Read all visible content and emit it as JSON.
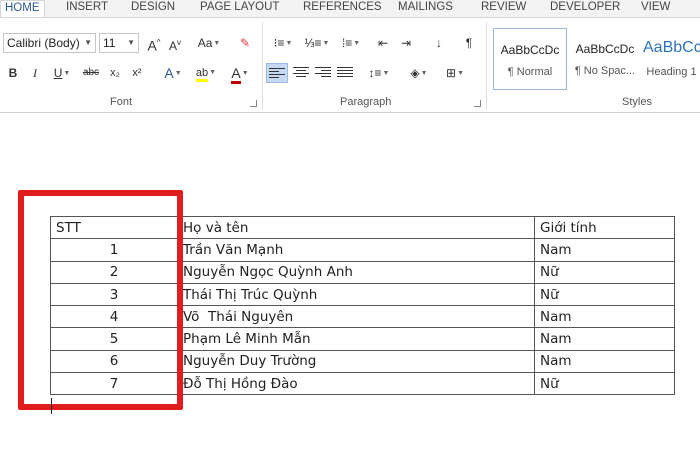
{
  "tabs": [
    "HOME",
    "INSERT",
    "DESIGN",
    "PAGE LAYOUT",
    "REFERENCES",
    "MAILINGS",
    "REVIEW",
    "DEVELOPER",
    "VIEW"
  ],
  "font_group": {
    "label": "Font",
    "font_name": "Calibri (Body)",
    "font_size": "11",
    "grow_label": "A",
    "shrink_label": "A",
    "case_label": "Aa",
    "bold": "B",
    "italic": "I",
    "underline": "U",
    "strike": "abc",
    "subscript": "x₂",
    "superscript": "x²",
    "effects_label": "A",
    "highlight_label": "ab",
    "color_label": "A"
  },
  "paragraph_group": {
    "label": "Paragraph",
    "pilcrow": "¶"
  },
  "styles_group": {
    "label": "Styles",
    "items": [
      {
        "sample": "AaBbCcDc",
        "name": "¶ Normal"
      },
      {
        "sample": "AaBbCcDc",
        "name": "¶ No Spac..."
      },
      {
        "sample": "AaBbCc",
        "name": "Heading 1"
      }
    ]
  },
  "table": {
    "header": {
      "stt": "STT",
      "name": "Họ và tên",
      "gender": "Giới tính"
    },
    "rows": [
      {
        "stt": "1",
        "name": "Trần Văn Mạnh",
        "gender": "Nam"
      },
      {
        "stt": "2",
        "name": "Nguyễn Ngọc Quỳnh Anh",
        "gender": "Nữ"
      },
      {
        "stt": "3",
        "name": "Thái Thị Trúc Quỳnh",
        "gender": "Nữ"
      },
      {
        "stt": "4",
        "name": "Võ  Thái Nguyên",
        "gender": "Nam"
      },
      {
        "stt": "5",
        "name": "Phạm Lê Minh Mẫn",
        "gender": "Nam"
      },
      {
        "stt": "6",
        "name": "Nguyễn Duy Trường",
        "gender": "Nam"
      },
      {
        "stt": "7",
        "name": "Đỗ Thị Hồng Đào",
        "gender": "Nữ"
      }
    ]
  },
  "colors": {
    "accent": "#2b579a",
    "highlight_box": "#e01e1e"
  }
}
